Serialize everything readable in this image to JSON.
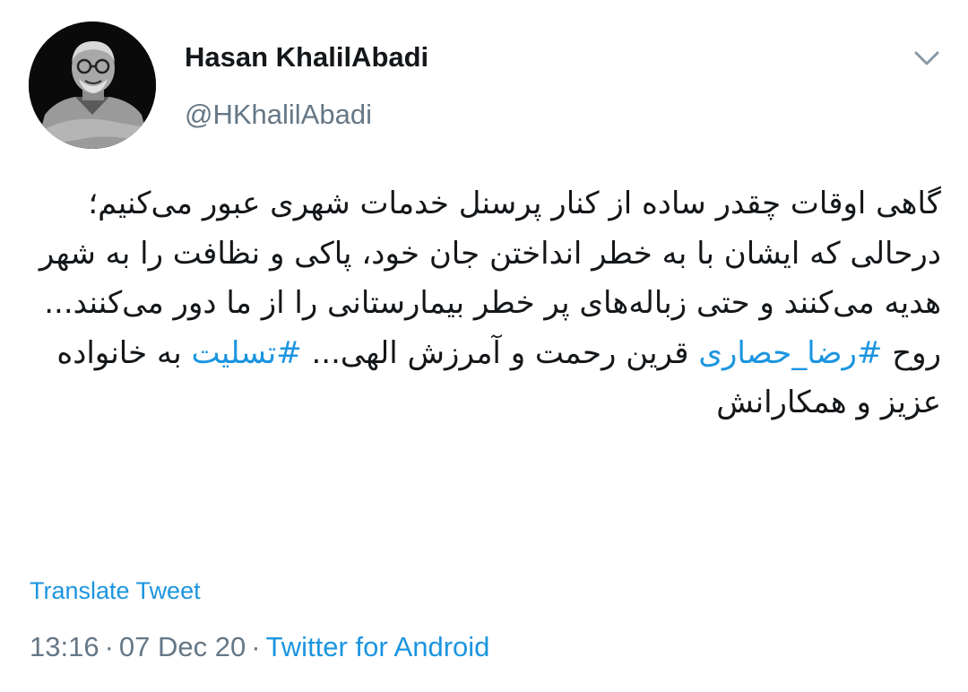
{
  "author": {
    "display_name": "Hasan KhalilAbadi",
    "handle": "@HKhalilAbadi",
    "avatar_icon": "profile-photo"
  },
  "menu_icon": "chevron-down-icon",
  "tweet": {
    "paragraph1": "گاهی اوقات چقدر ساده از کنار پرسنل خدمات شهری عبور می‌کنیم؛ درحالی که ایشان با به خطر انداختن جان خود، پاکی و نظافت را به شهر هدیه می‌کنند و حتی زباله‌های پر خطر بیمارستانی را از ما دور می‌کنند...",
    "p2_before": "روح ",
    "hashtag1": "#رضا_حصاری",
    "p2_middle": " قرین رحمت و آمرزش الهی... ",
    "hashtag2": "#تسلیت",
    "p2_after": " به خانواده عزیز و همکارانش"
  },
  "translate_label": "Translate Tweet",
  "meta": {
    "time": "13:16",
    "separator": "·",
    "date": "07 Dec 20",
    "source": "Twitter for Android"
  },
  "colors": {
    "link": "#1b95e0",
    "secondary_text": "#657786",
    "primary_text": "#14171a"
  }
}
